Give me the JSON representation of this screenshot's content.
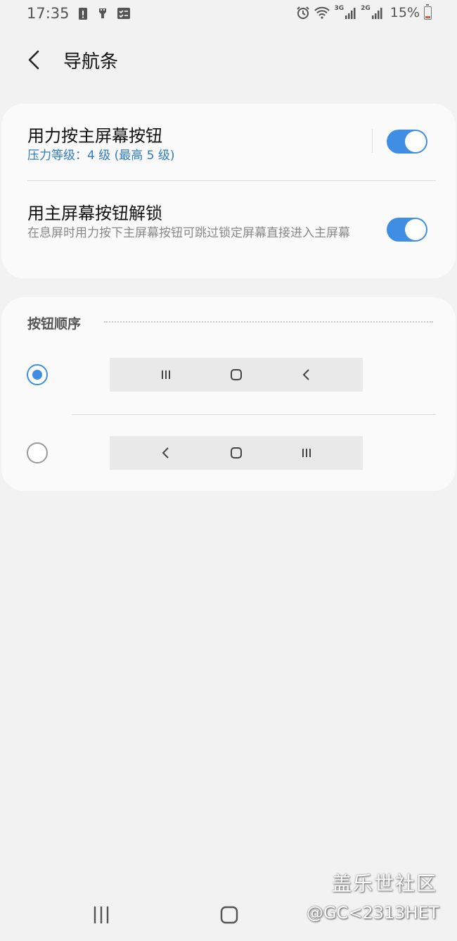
{
  "status_bar": {
    "time": "17:35",
    "network_3g": "3G",
    "network_2g": "2G",
    "battery": "15%",
    "battery_level": 0.15
  },
  "header": {
    "title": "导航条",
    "back_icon": "chevron-left-icon"
  },
  "settings": [
    {
      "title": "用力按主屏幕按钮",
      "subtitle": "压力等级：4 级 (最高 5 级)",
      "subtitle_color": "#2f7cc0",
      "enabled": true
    },
    {
      "title": "用主屏幕按钮解锁",
      "subtitle": "在息屏时用力按下主屏幕按钮可跳过锁定屏幕直接进入主屏幕",
      "enabled": true
    }
  ],
  "button_order": {
    "label": "按钮顺序",
    "options": [
      {
        "selected": true,
        "buttons": [
          "recents-icon",
          "home-icon",
          "back-icon"
        ]
      },
      {
        "selected": false,
        "buttons": [
          "back-icon",
          "home-icon",
          "recents-icon"
        ]
      }
    ]
  },
  "bottom_nav": [
    "recents-icon",
    "home-icon"
  ],
  "watermark": {
    "title": "盖乐世社区",
    "handle": "@GC<2313HET"
  },
  "colors": {
    "accent": "#3f8ee3",
    "background": "#f2f2f2",
    "card": "#fafafa"
  }
}
